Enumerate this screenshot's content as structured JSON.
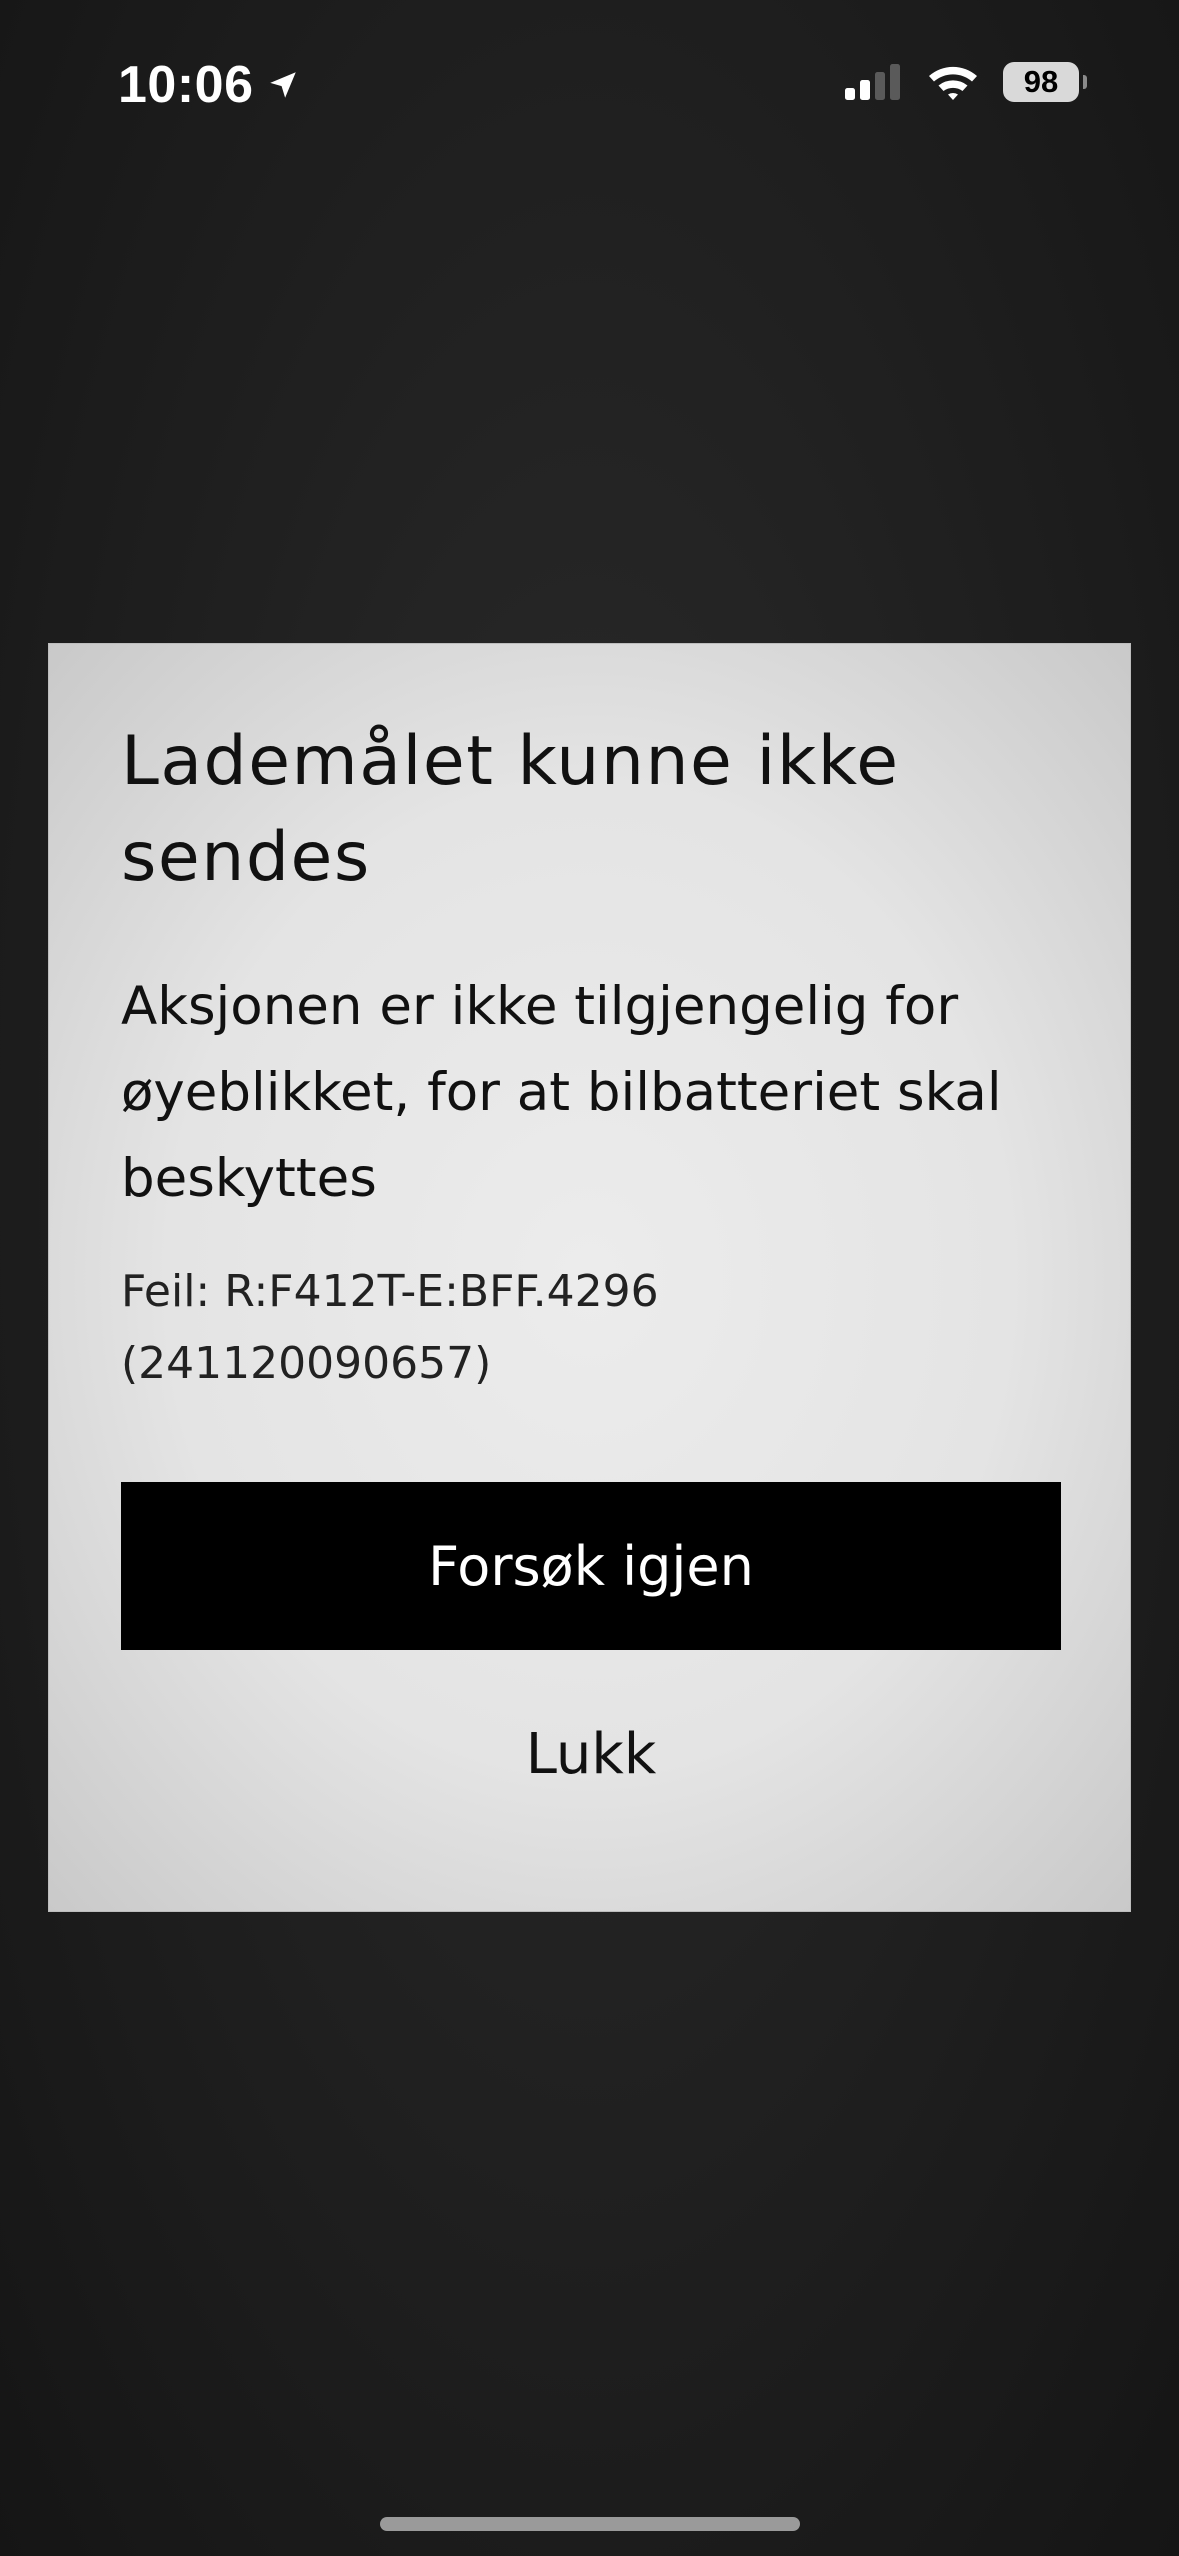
{
  "status_bar": {
    "time": "10:06",
    "battery_level": "98",
    "icons": [
      "location-arrow-icon",
      "cellular-signal-icon",
      "wifi-icon",
      "battery-icon"
    ]
  },
  "dialog": {
    "title": "Lademålet kunne ikke sendes",
    "message": "Aksjonen er ikke tilgjengelig for øyeblikket, for at bilbatteriet skal beskyttes",
    "error_line1": "Feil: R:F412T-E:BFF.4296",
    "error_line2": "(241120090657)",
    "primary_button_label": "Forsøk igjen",
    "secondary_button_label": "Lukk"
  },
  "colors": {
    "background": "#1f1f1f",
    "dialog_background": "#e4e4e4",
    "primary_button": "#000000",
    "primary_button_text": "#ffffff",
    "text": "#111111"
  }
}
